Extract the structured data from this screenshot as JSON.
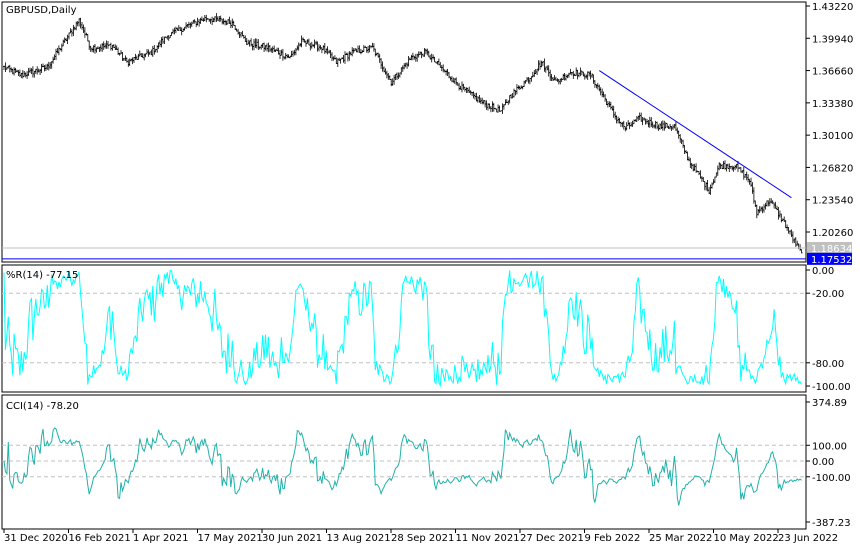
{
  "chart_data": {
    "type": "line",
    "symbol_label": "GBPUSD,Daily",
    "price_axis": {
      "ticks": [
        "1.43220",
        "1.39940",
        "1.36660",
        "1.33380",
        "1.30100",
        "1.26820",
        "1.23540",
        "1.20260"
      ],
      "ylim": [
        1.17,
        1.436
      ]
    },
    "price_lines": [
      {
        "label": "1.18634",
        "value": 1.18634,
        "color": "#c0c0c0"
      },
      {
        "label": "1.17532",
        "value": 1.17532,
        "color": "#0000ff"
      }
    ],
    "trendline": {
      "from": {
        "bar": 412,
        "price": 1.3666
      },
      "to": {
        "bar": 545,
        "price": 1.2375
      },
      "color": "#0000ff"
    },
    "price_keypoints": [
      [
        0,
        1.37
      ],
      [
        12,
        1.362
      ],
      [
        30,
        1.37
      ],
      [
        40,
        1.392
      ],
      [
        52,
        1.418
      ],
      [
        60,
        1.39
      ],
      [
        75,
        1.392
      ],
      [
        85,
        1.375
      ],
      [
        102,
        1.385
      ],
      [
        113,
        1.402
      ],
      [
        127,
        1.412
      ],
      [
        140,
        1.42
      ],
      [
        158,
        1.415
      ],
      [
        168,
        1.395
      ],
      [
        182,
        1.39
      ],
      [
        198,
        1.38
      ],
      [
        206,
        1.396
      ],
      [
        220,
        1.39
      ],
      [
        230,
        1.375
      ],
      [
        241,
        1.385
      ],
      [
        255,
        1.39
      ],
      [
        268,
        1.355
      ],
      [
        282,
        1.38
      ],
      [
        292,
        1.385
      ],
      [
        302,
        1.37
      ],
      [
        316,
        1.35
      ],
      [
        330,
        1.335
      ],
      [
        344,
        1.325
      ],
      [
        350,
        1.34
      ],
      [
        364,
        1.36
      ],
      [
        372,
        1.375
      ],
      [
        382,
        1.355
      ],
      [
        392,
        1.365
      ],
      [
        406,
        1.362
      ],
      [
        413,
        1.345
      ],
      [
        423,
        1.32
      ],
      [
        430,
        1.308
      ],
      [
        440,
        1.318
      ],
      [
        454,
        1.31
      ],
      [
        464,
        1.31
      ],
      [
        474,
        1.275
      ],
      [
        488,
        1.245
      ],
      [
        495,
        1.27
      ],
      [
        506,
        1.27
      ],
      [
        516,
        1.255
      ],
      [
        521,
        1.222
      ],
      [
        530,
        1.235
      ],
      [
        540,
        1.212
      ],
      [
        552,
        1.18
      ]
    ],
    "x_ticks": [
      "31 Dec 2020",
      "16 Feb 2021",
      "1 Apr 2021",
      "17 May 2021",
      "30 Jun 2021",
      "13 Aug 2021",
      "28 Sep 2021",
      "11 Nov 2021",
      "27 Dec 2021",
      "9 Feb 2022",
      "25 Mar 2022",
      "10 May 2022",
      "23 Jun 2022"
    ],
    "indicators": [
      {
        "name": "%R(14)",
        "value_label": "-77.15",
        "ticks": [
          "0.00",
          "-20.00",
          "-80.00",
          "-100.00"
        ],
        "levels": [
          -20,
          -80
        ],
        "ylim": [
          -100,
          0
        ],
        "color": "#00ffff"
      },
      {
        "name": "CCI(14)",
        "value_label": "-78.20",
        "ticks": [
          "374.89",
          "100.00",
          "0.00",
          "-100.00",
          "-387.23"
        ],
        "levels": [
          100,
          0,
          -100
        ],
        "ylim": [
          -387.23,
          374.89
        ],
        "color": "#20b2aa"
      }
    ]
  }
}
